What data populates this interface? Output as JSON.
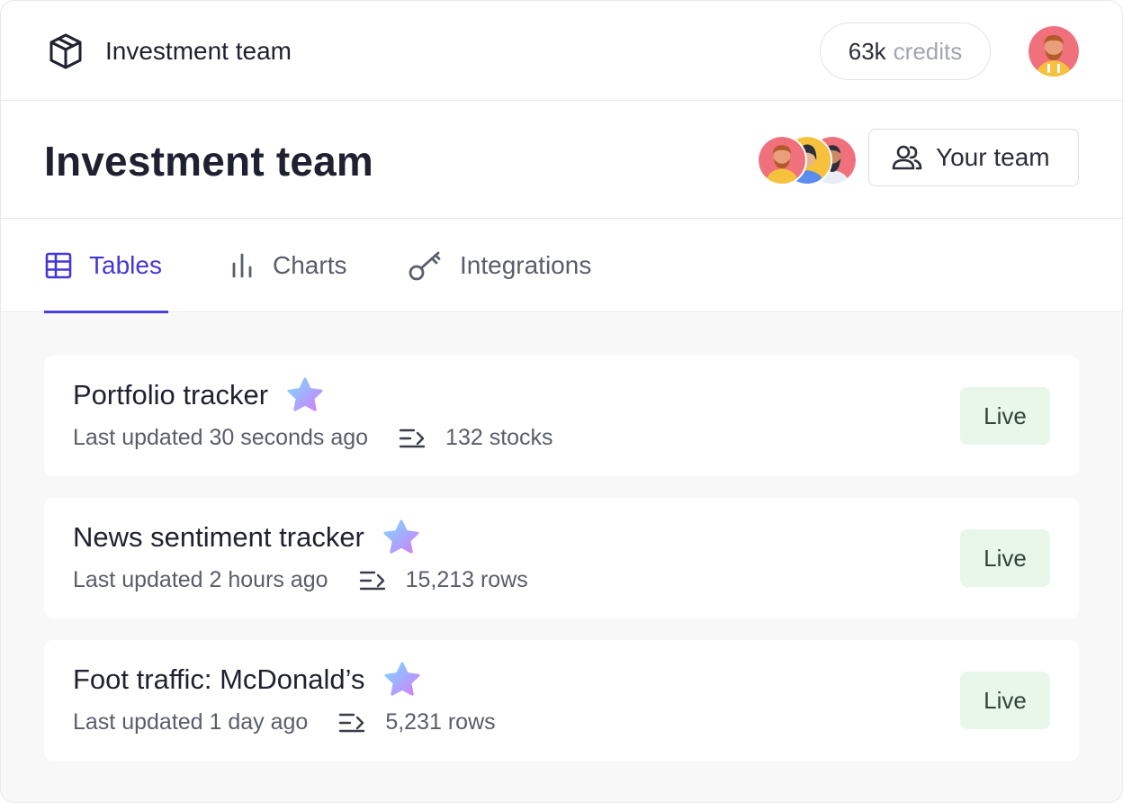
{
  "topbar": {
    "brand": "Investment team",
    "credits_value": "63k",
    "credits_unit": "credits",
    "logo_icon": "cube-icon"
  },
  "header": {
    "title": "Investment team",
    "team_button_label": "Your team",
    "team_icon": "users-icon"
  },
  "tabs": [
    {
      "label": "Tables",
      "icon": "table-icon",
      "active": true
    },
    {
      "label": "Charts",
      "icon": "bar-chart-icon",
      "active": false
    },
    {
      "label": "Integrations",
      "icon": "key-icon",
      "active": false
    }
  ],
  "tables": [
    {
      "title": "Portfolio tracker",
      "updated": "Last updated 30 seconds ago",
      "count": "132 stocks",
      "status": "Live"
    },
    {
      "title": "News sentiment tracker",
      "updated": "Last updated 2 hours ago",
      "count": "15,213 rows",
      "status": "Live"
    },
    {
      "title": "Foot traffic: McDonald’s",
      "updated": "Last updated 1 day ago",
      "count": "5,231 rows",
      "status": "Live"
    }
  ],
  "colors": {
    "accent": "#4338d6",
    "live_badge_bg": "#e8f7ea",
    "list_bg": "#f8f8f9"
  }
}
